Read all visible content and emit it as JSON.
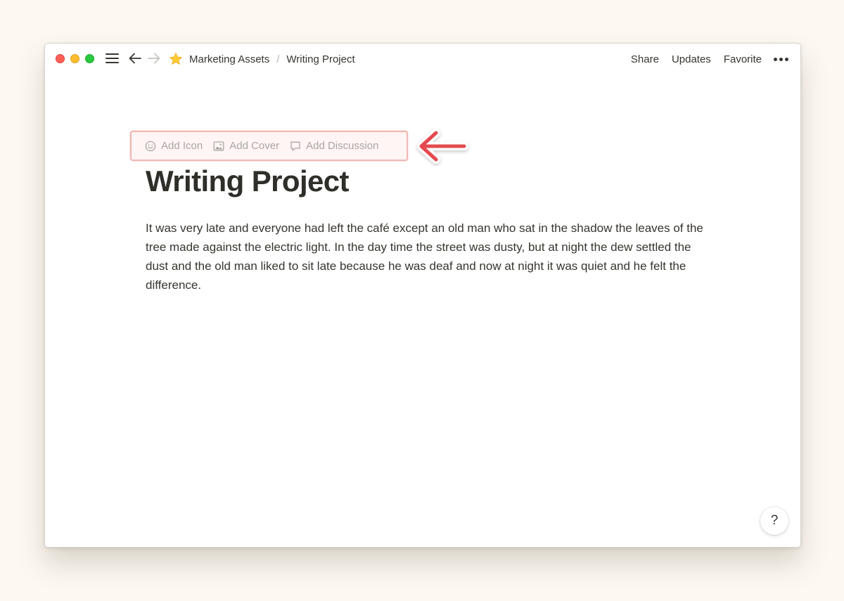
{
  "breadcrumb": {
    "items": [
      {
        "label": "Marketing Assets"
      },
      {
        "label": "Writing Project"
      }
    ],
    "separator": "/",
    "icon": "star-emoji"
  },
  "top_actions": {
    "share": "Share",
    "updates": "Updates",
    "favorite": "Favorite",
    "more_icon": "ellipsis-icon"
  },
  "page_controls": {
    "add_icon": "Add Icon",
    "add_cover": "Add Cover",
    "add_discussion": "Add Discussion"
  },
  "page": {
    "title": "Writing Project",
    "body": "It was very late and everyone had left the café except an old man who sat in the shadow the leaves of the tree made against the electric light. In the day time the street was dusty, but at night the dew settled the dust and the old man liked to sit late because he was deaf and now at night it was quiet and he felt the difference."
  },
  "help": {
    "label": "?"
  },
  "colors": {
    "background": "#fdf8f2",
    "window": "#ffffff",
    "text": "#37352f",
    "muted_text": "#a8a6a2",
    "highlight_border": "#f1b8b4",
    "callout_arrow": "#e5484d",
    "close": "#fe5f57",
    "minimize": "#febc2e",
    "maximize": "#28c840"
  }
}
